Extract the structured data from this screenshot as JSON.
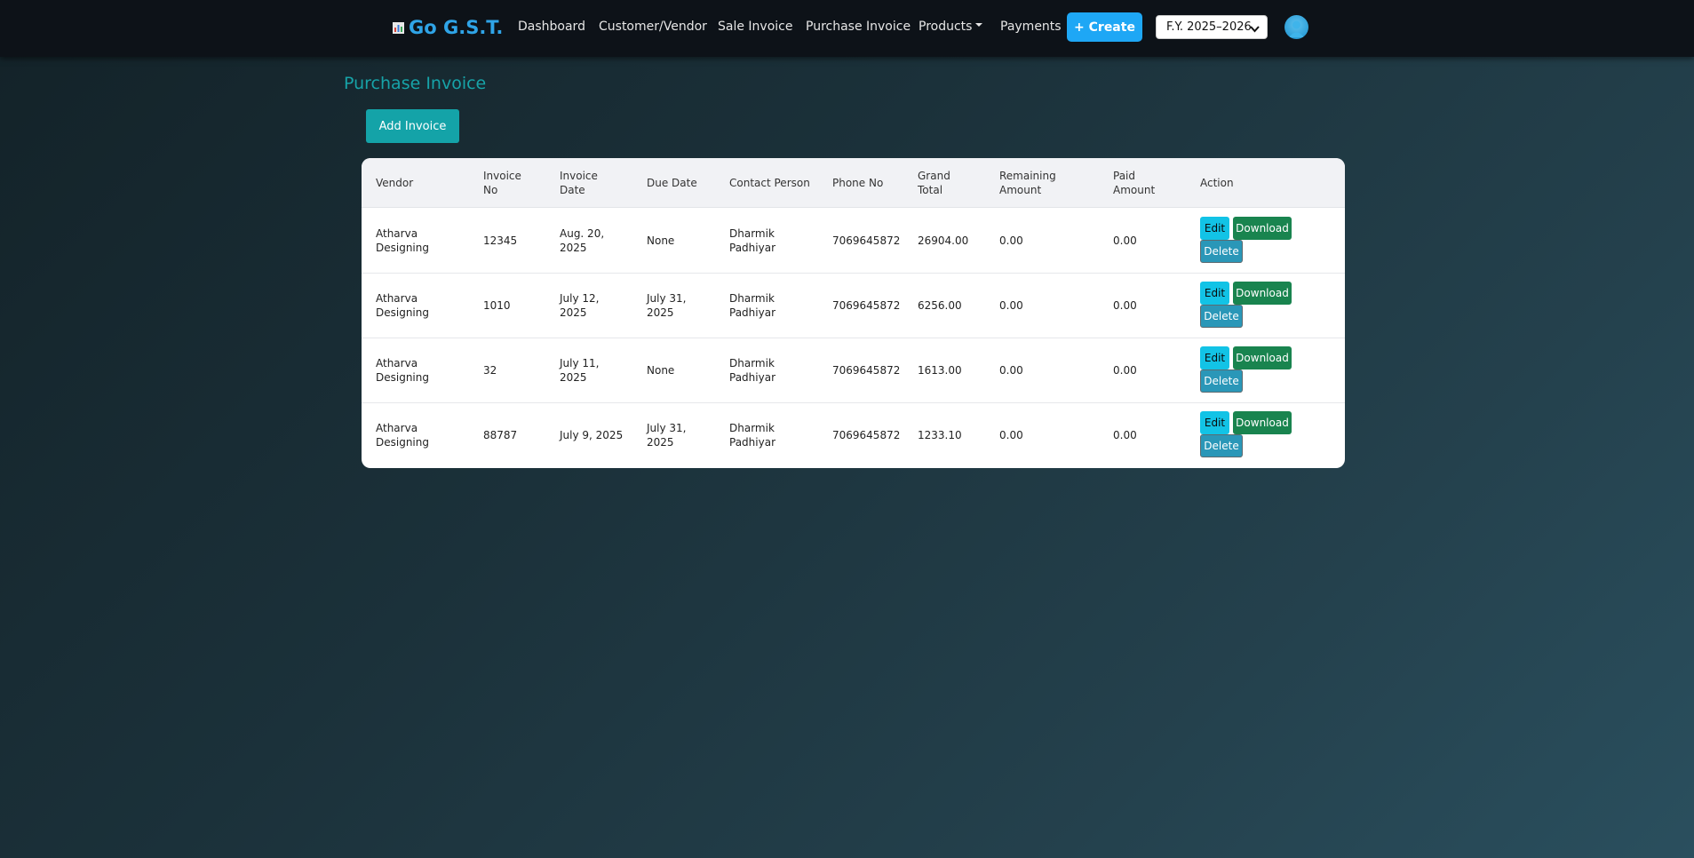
{
  "navbar": {
    "brand": "Go G.S.T.",
    "brand_icon": "bar-chart-icon",
    "links": [
      "Dashboard",
      "Customer/Vendor",
      "Sale Invoice",
      "Purchase Invoice",
      "Products",
      "Payments"
    ],
    "create_label": "+ Create",
    "fy_selected": "F.Y. 2025–2026",
    "avatar_icon": "user-icon"
  },
  "page": {
    "title": "Purchase Invoice",
    "add_button": "Add Invoice"
  },
  "table": {
    "headers": [
      [
        "Vendor",
        ""
      ],
      [
        "Invoice",
        "No"
      ],
      [
        "Invoice",
        "Date"
      ],
      [
        "Due Date",
        ""
      ],
      [
        "Contact Person",
        ""
      ],
      [
        "Phone No",
        ""
      ],
      [
        "Grand",
        "Total"
      ],
      [
        "Remaining",
        "Amount"
      ],
      [
        "Paid",
        "Amount"
      ],
      [
        "Action",
        ""
      ]
    ],
    "rows": [
      {
        "vendor": [
          "Atharva",
          "Designing"
        ],
        "invoice_no": "12345",
        "invoice_date": [
          "Aug. 20,",
          "2025"
        ],
        "due_date": [
          "None",
          ""
        ],
        "contact": [
          "Dharmik",
          "Padhiyar"
        ],
        "phone": "7069645872",
        "grand_total": "26904.00",
        "remaining": "0.00",
        "paid": "0.00"
      },
      {
        "vendor": [
          "Atharva",
          "Designing"
        ],
        "invoice_no": "1010",
        "invoice_date": [
          "July 12,",
          "2025"
        ],
        "due_date": [
          "July 31,",
          "2025"
        ],
        "contact": [
          "Dharmik",
          "Padhiyar"
        ],
        "phone": "7069645872",
        "grand_total": "6256.00",
        "remaining": "0.00",
        "paid": "0.00"
      },
      {
        "vendor": [
          "Atharva",
          "Designing"
        ],
        "invoice_no": "32",
        "invoice_date": [
          "July 11,",
          "2025"
        ],
        "due_date": [
          "None",
          ""
        ],
        "contact": [
          "Dharmik",
          "Padhiyar"
        ],
        "phone": "7069645872",
        "grand_total": "1613.00",
        "remaining": "0.00",
        "paid": "0.00"
      },
      {
        "vendor": [
          "Atharva",
          "Designing"
        ],
        "invoice_no": "88787",
        "invoice_date": [
          "July 9, 2025",
          ""
        ],
        "due_date": [
          "July 31,",
          "2025"
        ],
        "contact": [
          "Dharmik",
          "Padhiyar"
        ],
        "phone": "7069645872",
        "grand_total": "1233.10",
        "remaining": "0.00",
        "paid": "0.00"
      }
    ],
    "actions": {
      "edit": "Edit",
      "download": "Download",
      "delete": "Delete"
    }
  },
  "colors": {
    "accent": "#1ea7f5",
    "teal": "#14a3a8",
    "download": "#19844f",
    "edit": "#12c3e6",
    "delete": "#2a97b8"
  }
}
